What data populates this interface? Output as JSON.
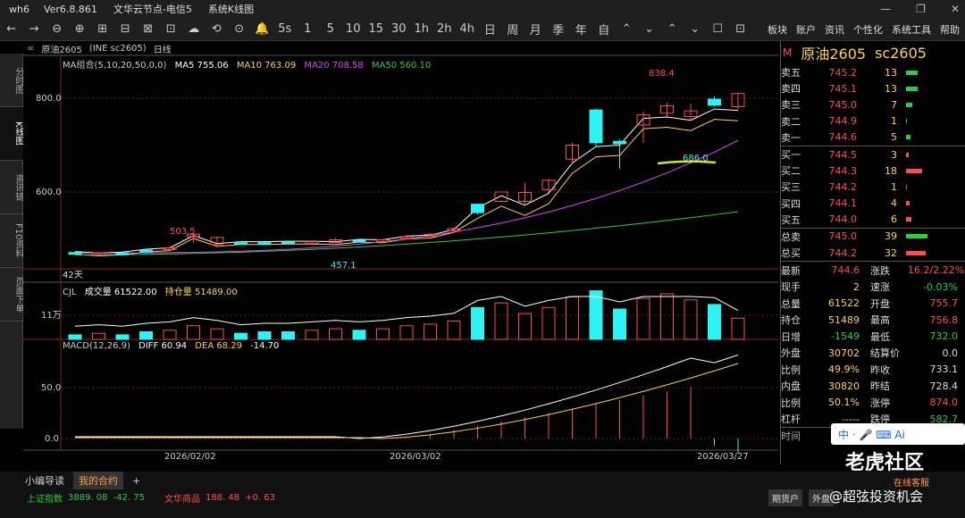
{
  "window": {
    "app": "wh6",
    "version": "Ver6.8.861",
    "node": "文华云节点-电信5",
    "view": "系统K线图",
    "controls": [
      "—",
      "❐",
      "✕"
    ]
  },
  "toolbar": {
    "left": [
      "←",
      "→",
      "⊖",
      "⊕",
      "⊞",
      "⊟",
      "⊠",
      "⊡",
      "☁",
      "⟲",
      "⊙",
      "🔔",
      "5s",
      "1",
      "5",
      "10",
      "15",
      "30",
      "1h",
      "2h",
      "4h",
      "日",
      "周",
      "月",
      "季",
      "年",
      "自",
      "⌃",
      "⌄",
      "⌃",
      "⌄",
      "☐",
      "⊡"
    ],
    "right": [
      "板块",
      "账户",
      "资讯",
      "个性化",
      "系统工具",
      "帮助"
    ]
  },
  "leftnav": [
    "分时图",
    "K线图",
    "资讯链",
    "F10资料",
    "页面下单"
  ],
  "chart": {
    "symbol_label": "原油2605",
    "code": "(INE sc2605)",
    "period": "日线",
    "ma_label": "MA组合(5,10,20,50,0,0)",
    "ma5": "MA5 755.06",
    "ma10": "MA10 763.09",
    "ma20": "MA20 708.58",
    "ma50": "MA50 560.10",
    "vol_label": "CJL",
    "vol_val": "成交量 61522.00",
    "oi_val": "持仓量 51489.00",
    "macd_label": "MACD(12,26,9)",
    "diff": "DIFF 60.94",
    "dea": "DEA 68.29",
    "macd": "-14.70",
    "annot_high": "838.4",
    "annot_mid": "686.0",
    "annot_low_a": "503.5",
    "annot_low_b": "457.1",
    "days": "42天",
    "y_800": "800.0",
    "y_600": "600.0",
    "y_11w": "11万",
    "y_50": "50.0",
    "y_0": "0.0",
    "dates": [
      "2026/02/02",
      "2026/03/02",
      "2026/03/27"
    ]
  },
  "quote": {
    "title": "原油2605",
    "code": "sc2605",
    "asks": [
      [
        "卖五",
        "745.2",
        "13",
        0.22
      ],
      [
        "卖四",
        "745.1",
        "13",
        0.22
      ],
      [
        "卖三",
        "745.0",
        "7",
        0.12
      ],
      [
        "卖二",
        "744.9",
        "1",
        0.02
      ],
      [
        "卖一",
        "744.6",
        "5",
        0.08
      ]
    ],
    "bids": [
      [
        "买一",
        "744.5",
        "3",
        0.05
      ],
      [
        "买二",
        "744.3",
        "18",
        0.3
      ],
      [
        "买三",
        "744.2",
        "1",
        0.02
      ],
      [
        "买四",
        "744.1",
        "4",
        0.07
      ],
      [
        "买五",
        "744.0",
        "6",
        0.1
      ]
    ],
    "sell_total_label": "总卖",
    "sell_total": "745.0",
    "sell_total_v": "39",
    "buy_total_label": "总买",
    "buy_total": "744.2",
    "buy_total_v": "32",
    "rows": [
      [
        "最新",
        "744.6",
        "涨跌",
        "16.2/2.22%"
      ],
      [
        "现手",
        "2",
        "速涨",
        "-0.03%"
      ],
      [
        "总量",
        "61522",
        "开盘",
        "755.7"
      ],
      [
        "持仓",
        "51489",
        "最高",
        "756.8"
      ],
      [
        "日增",
        "-1549",
        "最低",
        "732.0"
      ],
      [
        "外盘",
        "30702",
        "结算价",
        "0.0"
      ],
      [
        "比例",
        "49.9%",
        "昨收",
        "733.1"
      ],
      [
        "内盘",
        "30820",
        "昨结",
        "728.4"
      ],
      [
        "比例",
        "50.1%",
        "涨停",
        "874.0"
      ],
      [
        "杠杆",
        "-----",
        "跌停",
        "582.7"
      ]
    ],
    "time_label": "时间"
  },
  "bottom": {
    "tabs": [
      "小编导读",
      "我的合约",
      "+"
    ],
    "idx1": "上证指数",
    "idx1v": "3889. 08",
    "idx1c": "-42. 75",
    "idx2": "文华商品",
    "idx2v": "188. 48",
    "idx2c": "+0. 63",
    "btns": [
      "期货户",
      "外盘"
    ],
    "watermark": "老虎社区",
    "service": "在线客服",
    "handle": "@超弦投资机会",
    "ime": "中 · 🎤 ⌨ Ai"
  }
}
